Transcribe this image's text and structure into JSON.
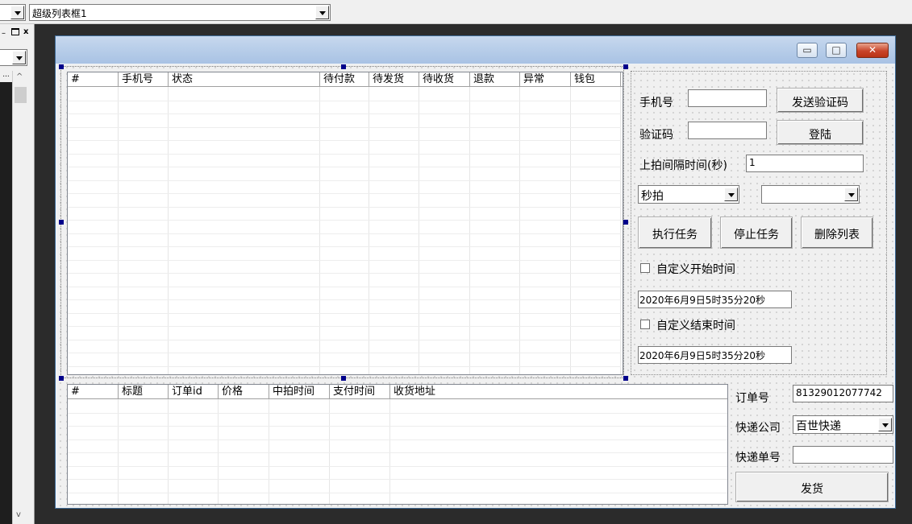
{
  "toolbar": {
    "control_selector": "超级列表框1"
  },
  "left_dock": {
    "scroll_up": "^",
    "scroll_down": "v",
    "more_button": "..."
  },
  "window": {
    "min_glyph": "▭",
    "max_glyph": "□",
    "close_glyph": "✕"
  },
  "accounts_list": {
    "columns": [
      "#",
      "手机号",
      "状态",
      "待付款",
      "待发货",
      "待收货",
      "退款",
      "异常",
      "钱包"
    ]
  },
  "orders_list": {
    "columns": [
      "#",
      "标题",
      "订单id",
      "价格",
      "中拍时间",
      "支付时间",
      "收货地址"
    ]
  },
  "login_panel": {
    "phone_label": "手机号",
    "phone_value": "",
    "send_code_label": "发送验证码",
    "code_label": "验证码",
    "code_value": "",
    "login_label": "登陆",
    "interval_label": "上拍间隔时间(秒)",
    "interval_value": "1",
    "mode_select": "秒拍",
    "second_select": "",
    "run_task_label": "执行任务",
    "stop_task_label": "停止任务",
    "delete_list_label": "删除列表",
    "custom_start_label": "自定义开始时间",
    "start_time_value": "2020年6月9日5时35分20秒",
    "custom_end_label": "自定义结束时间",
    "end_time_value": "2020年6月9日5时35分20秒"
  },
  "shipping_panel": {
    "order_no_label": "订单号",
    "order_no_value": "81329012077742",
    "courier_label": "快递公司",
    "courier_value": "百世快递",
    "tracking_label": "快递单号",
    "tracking_value": "",
    "ship_label": "发货"
  }
}
